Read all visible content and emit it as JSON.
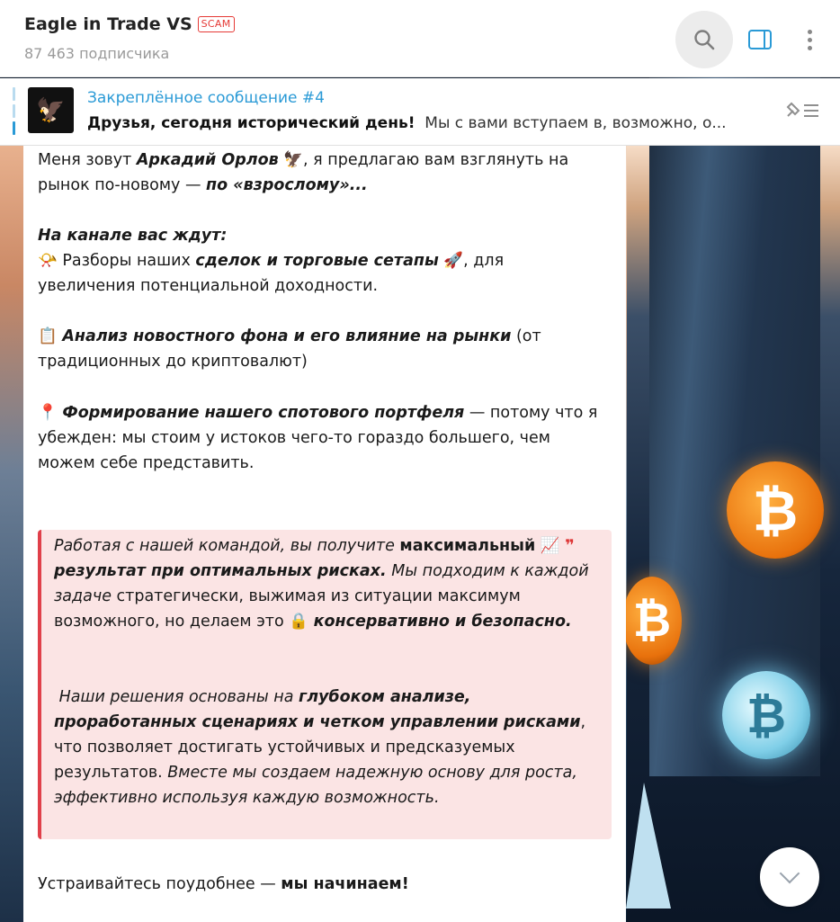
{
  "header": {
    "title": "Eagle in Trade VS",
    "badge": "SCAM",
    "subscribers": "87 463 подписчика"
  },
  "pinned": {
    "title": "Закреплённое сообщение #4",
    "bold": "Друзья, сегодня исторический день!",
    "text": "Мы с вами вступаем в, возможно, о..."
  },
  "message": {
    "intro": {
      "p1": "Меня зовут ",
      "name": "Аркадий Орлов",
      "p2": ", я предлагаю вам взглянуть на рынок по-новому — ",
      "adult": "по «взрослому»..."
    },
    "heading": "На канале вас ждут:",
    "item1": {
      "p1": "Разборы наших ",
      "bold": "сделок и торговые сетапы",
      "p2": ", для увеличения потенциальной доходности."
    },
    "item2": {
      "bold": "Анализ новостного фона и его влияние на рынки",
      "p2": " (от традиционных до криптовалют)"
    },
    "item3": {
      "bold": "Формирование нашего спотового портфеля",
      "p2": " — потому что я убежден: мы стоим у истоков чего-то гораздо большего, чем можем себе представить."
    },
    "quote": {
      "a1": "Работая с нашей командой, вы получите ",
      "a2": "максимальный",
      "a3": "результат при оптимальных рисках.",
      "a4": " Мы подходим к каждой задаче ",
      "a5": "стратегически, выжимая из ситуации максимум возможного, но делаем это ",
      "a6": "консервативно и безопасно.",
      "b1": "Наши решения основаны на ",
      "b2": "глубоком анализе, проработанных сценариях и четком управлении рисками",
      "b3": ", что позволяет достигать устойчивых и предсказуемых результатов. ",
      "b4": "Вместе мы создаем надежную основу для роста, эффективно используя каждую возможность."
    },
    "outro": {
      "p1": "Устраивайтесь поудобнее — ",
      "bold": "мы начинаем!"
    }
  },
  "icons": {
    "search": "search-icon",
    "panel": "sidebar-panel-icon",
    "more": "more-vertical-icon",
    "pin_list": "pinned-list-icon",
    "scroll_down": "chevron-down-icon"
  },
  "colors": {
    "accent": "#2a9ad6",
    "scam": "#e53935",
    "quote_bar": "#e0404a",
    "quote_bg": "#fbe4e4"
  }
}
